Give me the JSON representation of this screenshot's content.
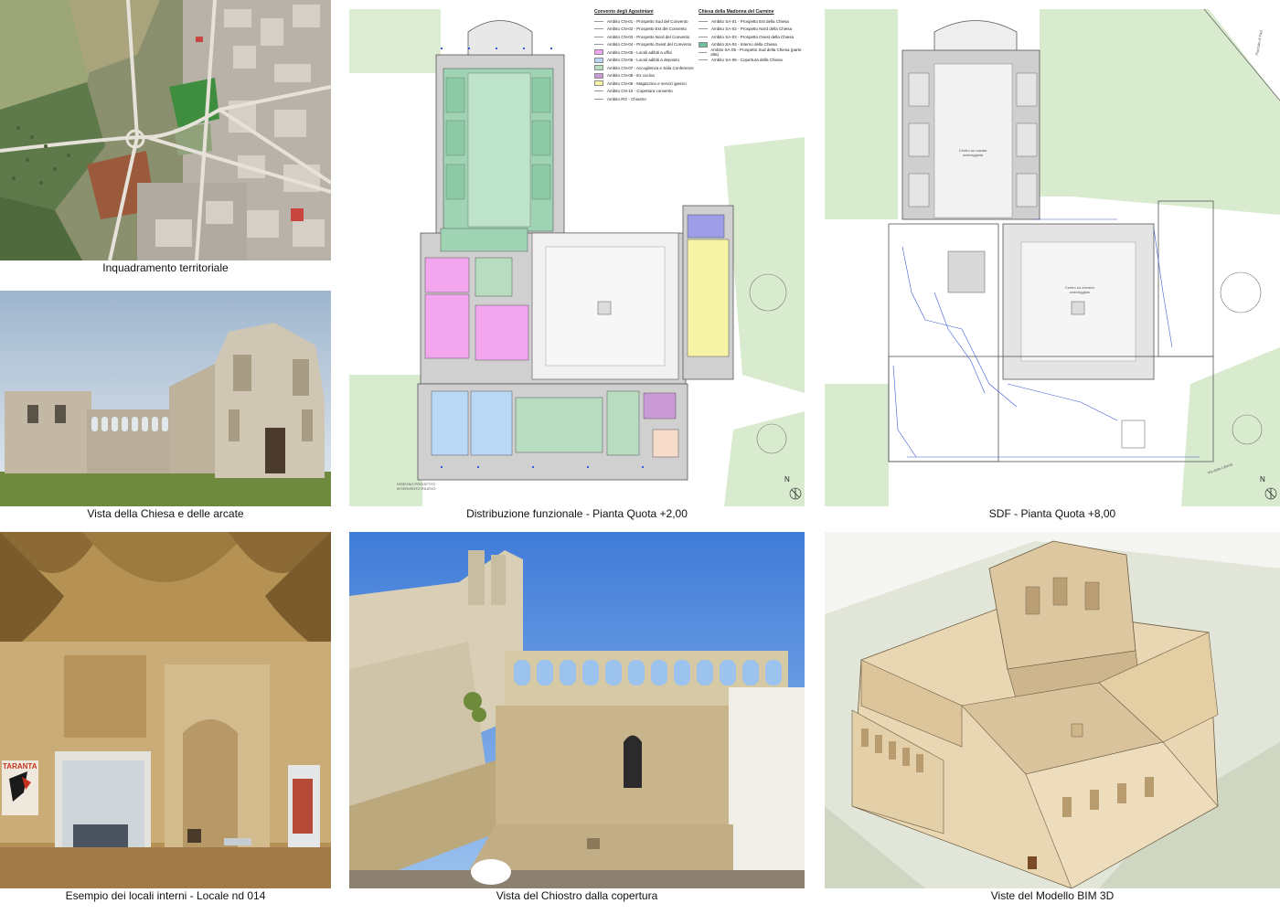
{
  "panels": [
    {
      "id": "aerial",
      "caption": "Inquadramento territoriale"
    },
    {
      "id": "church",
      "caption": "Vista della Chiesa e delle arcate"
    },
    {
      "id": "plan2",
      "caption": "Distribuzione funzionale - Pianta Quota +2,00"
    },
    {
      "id": "plan8",
      "caption": "SDF - Pianta Quota +8,00"
    },
    {
      "id": "interior",
      "caption": "Esempio dei locali interni - Locale nd 014"
    },
    {
      "id": "cloister",
      "caption": "Vista del Chiostro dalla copertura"
    },
    {
      "id": "bim",
      "caption": "Viste del Modello BIM 3D"
    }
  ],
  "legend": {
    "convento_title": "Convento degli Agostiniani",
    "convento_items": [
      {
        "label": "Ambito CN-01 - Prospetto Sud del Convento",
        "color": ""
      },
      {
        "label": "Ambito CN-02 - Prospetto Est del Convento",
        "color": ""
      },
      {
        "label": "Ambito CN-03 - Prospetto Nord del Convento",
        "color": ""
      },
      {
        "label": "Ambito CN-04 - Prospetto Ovest del Convento",
        "color": ""
      },
      {
        "label": "Ambito CN-05 - Locali adibiti a uffici",
        "color": "#f2a6ee"
      },
      {
        "label": "Ambito CN-06 - Locali adibiti a deposito",
        "color": "#b9d8f5"
      },
      {
        "label": "Ambito CN-07 - Accoglienza e Sala Conferenze",
        "color": "#b8dcc0"
      },
      {
        "label": "Ambito CN-08 - Ex cucina",
        "color": "#c99ad6"
      },
      {
        "label": "Ambito CN-09 - Magazzino e servizi igienici",
        "color": "#f6f3a6"
      },
      {
        "label": "Ambito CN-10 - Copertura convento",
        "color": ""
      },
      {
        "label": "Ambito RO - Chiostro",
        "color": ""
      }
    ],
    "chiesa_title": "Chiesa della Madonna del Carmine",
    "chiesa_items": [
      {
        "label": "Ambito SA-01 - Prospetto Est della Chiesa",
        "color": ""
      },
      {
        "label": "Ambito SA-02 - Prospetto Nord della Chiesa",
        "color": ""
      },
      {
        "label": "Ambito SA-03 - Prospetto Ovest della Chiesa",
        "color": ""
      },
      {
        "label": "Ambito SA-04 - Interno della Chiesa",
        "color": "#6fbf9a"
      },
      {
        "label": "Ambito SA-05 - Prospetto Sud della Chiesa (parte alta)",
        "color": ""
      },
      {
        "label": "Ambito SA-06 - Copertura della Chiesa",
        "color": ""
      }
    ]
  },
  "north_label": "N",
  "plan8_labels": {
    "church_note": "Centro su navata ombreggiata",
    "cloister_note": "Centro su chiostro ombreggiato",
    "street_right": "Piazzale di Fazi",
    "street_bottom": "Via della Libertà"
  },
  "plan2_labels": {
    "footer_note": "DISEGNO PROGETTO INTERVENTO RILIEVO"
  },
  "poster_text": "TARANTA",
  "colors": {
    "office_pink": "#f2a6ee",
    "deposit_blue": "#b9d8f5",
    "reception_green": "#b8dcc0",
    "kitchen_purple": "#c99ad6",
    "storage_yellow": "#f6f3a6",
    "church_green": "#6fbf9a",
    "lawn": "#d9ebcf",
    "bim_stone": "#ead8b8"
  }
}
